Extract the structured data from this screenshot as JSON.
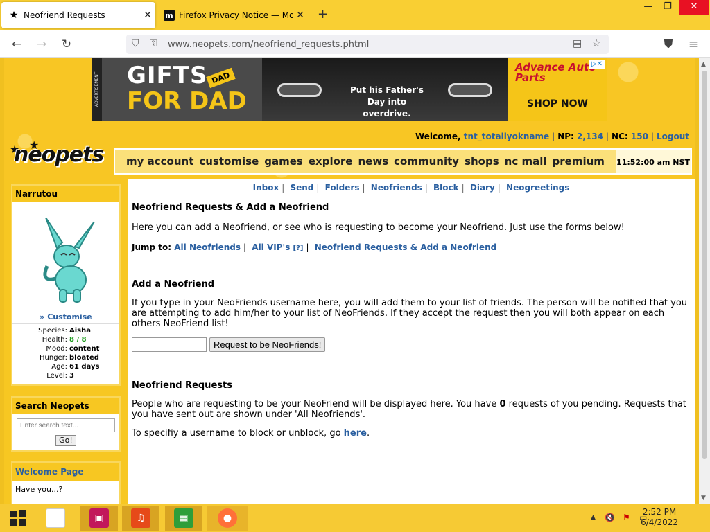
{
  "browser": {
    "tabs": [
      {
        "title": "Neofriend Requests",
        "favicon": "star-icon",
        "active": true
      },
      {
        "title": "Firefox Privacy Notice — Mozilla",
        "favicon": "m",
        "active": false
      }
    ],
    "url": "www.neopets.com/neofriend_requests.phtml",
    "new_tab_glyph": "+",
    "window_controls": {
      "minimize": "—",
      "maximize": "❐",
      "close": "✕"
    }
  },
  "ad": {
    "label": "ADVERTISEMENT",
    "line1": "GIFTS",
    "line2": "FOR DAD",
    "dad_tag": "DAD",
    "tagline": "Put his Father's Day into overdrive.",
    "brand": "Advance Auto Parts",
    "cta": "SHOP NOW"
  },
  "header": {
    "welcome_prefix": "Welcome,",
    "username": "tnt_totallyokname",
    "np_label": "NP:",
    "np_value": "2,134",
    "nc_label": "NC:",
    "nc_value": "150",
    "logout": "Logout",
    "logo": "neopets",
    "time": "11:52:00 am NST"
  },
  "mainnav": [
    "my account",
    "customise",
    "games",
    "explore",
    "news",
    "community",
    "shops",
    "nc mall",
    "premium"
  ],
  "sidebar": {
    "pet_name": "Narrutou",
    "customise": "» Customise",
    "stats": [
      {
        "label": "Species:",
        "value": "Aisha"
      },
      {
        "label": "Health:",
        "value": "8 / 8"
      },
      {
        "label": "Mood:",
        "value": "content"
      },
      {
        "label": "Hunger:",
        "value": "bloated"
      },
      {
        "label": "Age:",
        "value": "61 days"
      },
      {
        "label": "Level:",
        "value": "3"
      }
    ],
    "search_title": "Search Neopets",
    "search_placeholder": "Enter search text...",
    "search_go": "Go!",
    "welcome_title": "Welcome Page",
    "have_you": "Have you...?"
  },
  "content": {
    "topnav": [
      "Inbox",
      "Send",
      "Folders",
      "Neofriends",
      "Block",
      "Diary",
      "Neogreetings"
    ],
    "title": "Neofriend Requests & Add a Neofriend",
    "intro": "Here you can add a Neofriend, or see who is requesting to become your Neofriend. Just use the forms below!",
    "jump_label": "Jump to:",
    "jump_links": [
      "All Neofriends",
      "All VIP's",
      "[?]",
      "Neofriend Requests & Add a Neofriend"
    ],
    "add_title": "Add a Neofriend",
    "add_text": "If you type in your NeoFriends username here, you will add them to your list of friends. The person will be notified that you are attempting to add him/her to your list of NeoFriends. If they accept the request then you will both appear on each others NeoFriend list!",
    "add_input_value": "",
    "add_button": "Request to be NeoFriends!",
    "req_title": "Neofriend Requests",
    "req_text_1": "People who are requesting to be your NeoFriend will be displayed here. You have",
    "req_count": "0",
    "req_text_2": "requests of you pending. Requests that you have sent out are shown under 'All Neofriends'.",
    "block_text": "To specifiy a username to block or unblock, go",
    "block_link": "here",
    "block_end": "."
  },
  "taskbar": {
    "clock_time": "2:52 PM",
    "clock_date": "6/4/2022"
  }
}
